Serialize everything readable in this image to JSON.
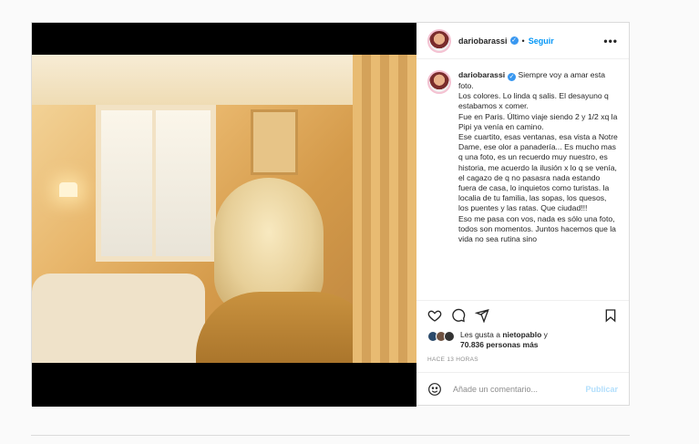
{
  "post": {
    "username": "dariobarassi",
    "follow_label": "Seguir",
    "dot": "•",
    "more": "•••",
    "caption_username": "dariobarassi",
    "caption_text": "Siempre voy a amar esta foto.\nLos colores. Lo linda q salis. El desayuno q estabamos x comer.\nFue en Paris. Último viaje siendo 2 y 1/2 xq la Pipi ya venía en camino.\nEse cuartito, esas ventanas, esa vista a Notre Dame, ese olor a panadería... Es mucho mas q una foto, es un recuerdo muy nuestro, es historia, me acuerdo la ilusión x lo q se venía, el cagazo de q no pasasra nada estando fuera de casa, lo inquietos como turistas. la localia de tu familia, las sopas, los quesos, los puentes y las ratas. Que ciudad!!!\nEso me pasa con vos, nada es sólo una foto, todos son momentos. Juntos hacemos que la vida no sea rutina sino",
    "likes_prefix": "Les gusta a ",
    "likes_user": "nietopablo",
    "likes_and": " y",
    "likes_count": "70.836 personas más",
    "timestamp": "HACE 13 HORAS",
    "comment_placeholder": "Añade un comentario...",
    "publish_label": "Publicar"
  },
  "colors": {
    "accent": "#0095f6",
    "publish_disabled": "#b2dffc",
    "verified": "#3897f0"
  },
  "icons": [
    "verified-badge-icon",
    "heart-icon",
    "comment-icon",
    "share-icon",
    "bookmark-icon",
    "emoji-icon"
  ]
}
